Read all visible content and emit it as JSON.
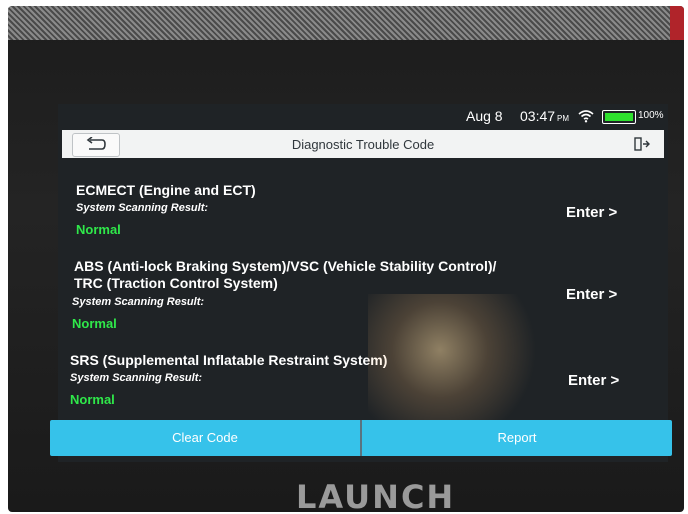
{
  "status": {
    "date": "Aug 8",
    "time": "03:47",
    "ampm": "PM",
    "battery": "100%"
  },
  "header": {
    "title": "Diagnostic Trouble Code"
  },
  "systems": [
    {
      "name_lines": [
        "ECMECT (Engine and ECT)"
      ],
      "result_label": "System Scanning Result:",
      "result": "Normal",
      "action": "Enter >"
    },
    {
      "name_lines": [
        "ABS (Anti-lock Braking System)/VSC (Vehicle Stability Control)/",
        "TRC (Traction Control System)"
      ],
      "result_label": "System Scanning Result:",
      "result": "Normal",
      "action": "Enter >"
    },
    {
      "name_lines": [
        "SRS (Supplemental Inflatable Restraint System)"
      ],
      "result_label": "System Scanning Result:",
      "result": "Normal",
      "action": "Enter >"
    }
  ],
  "footer": {
    "clear_label": "Clear Code",
    "report_label": "Report"
  },
  "device": {
    "brand": "LAUNCH"
  },
  "colors": {
    "accent": "#36c2ea",
    "status_ok": "#2fe84a",
    "battery": "#2ee02e"
  }
}
